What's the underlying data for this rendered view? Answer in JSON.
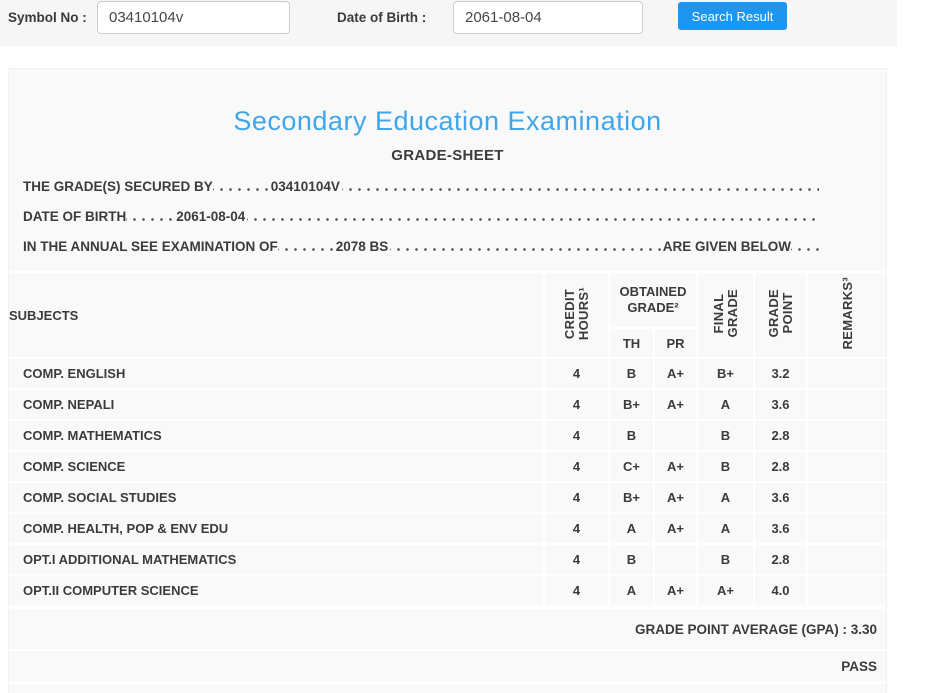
{
  "colors": {
    "title_blue": "#41a6e9",
    "button_blue": "#1d96f2",
    "card_background": "#f9f9f9",
    "topbar_background": "#f6f6f6",
    "text": "#3b3b3b"
  },
  "search_bar": {
    "symbol_label": "Symbol No :",
    "symbol_value": "03410104v",
    "dob_label": "Date of Birth :",
    "dob_value": "2061-08-04",
    "search_button": "Search Result"
  },
  "gradesheet": {
    "title": "Secondary Education Examination",
    "subtitle": "GRADE-SHEET",
    "statements": {
      "line1_label": "THE GRADE(S) SECURED BY",
      "line1_value": "03410104V",
      "line2_label": "DATE OF BIRTH",
      "line2_value": "2061-08-04",
      "line3_label": "IN THE ANNUAL SEE EXAMINATION OF",
      "line3_value": "2078 BS",
      "line3_suffix": "ARE GIVEN BELOW"
    },
    "table": {
      "col_subjects": "SUBJECTS",
      "col_credit_hours": "CREDIT\nHOURS¹",
      "col_obtained_grade": "OBTAINED GRADE²",
      "col_th": "TH",
      "col_pr": "PR",
      "col_final_grade": "FINAL\nGRADE",
      "col_grade_point": "GRADE\nPOINT",
      "col_remarks": "REMARKS³",
      "rows": [
        {
          "subject": "COMP. ENGLISH",
          "credit_hours": "4",
          "th": "B",
          "pr": "A+",
          "final_grade": "B+",
          "grade_point": "3.2",
          "remarks": ""
        },
        {
          "subject": "COMP. NEPALI",
          "credit_hours": "4",
          "th": "B+",
          "pr": "A+",
          "final_grade": "A",
          "grade_point": "3.6",
          "remarks": ""
        },
        {
          "subject": "COMP. MATHEMATICS",
          "credit_hours": "4",
          "th": "B",
          "pr": "",
          "final_grade": "B",
          "grade_point": "2.8",
          "remarks": ""
        },
        {
          "subject": "COMP. SCIENCE",
          "credit_hours": "4",
          "th": "C+",
          "pr": "A+",
          "final_grade": "B",
          "grade_point": "2.8",
          "remarks": ""
        },
        {
          "subject": "COMP. SOCIAL STUDIES",
          "credit_hours": "4",
          "th": "B+",
          "pr": "A+",
          "final_grade": "A",
          "grade_point": "3.6",
          "remarks": ""
        },
        {
          "subject": "COMP. HEALTH, POP & ENV EDU",
          "credit_hours": "4",
          "th": "A",
          "pr": "A+",
          "final_grade": "A",
          "grade_point": "3.6",
          "remarks": ""
        },
        {
          "subject": "OPT.I ADDITIONAL MATHEMATICS",
          "credit_hours": "4",
          "th": "B",
          "pr": "",
          "final_grade": "B",
          "grade_point": "2.8",
          "remarks": ""
        },
        {
          "subject": "OPT.II COMPUTER SCIENCE",
          "credit_hours": "4",
          "th": "A",
          "pr": "A+",
          "final_grade": "A+",
          "grade_point": "4.0",
          "remarks": ""
        }
      ]
    },
    "summary": {
      "gpa_text": "GRADE POINT AVERAGE (GPA) : 3.30",
      "result": "PASS"
    }
  }
}
